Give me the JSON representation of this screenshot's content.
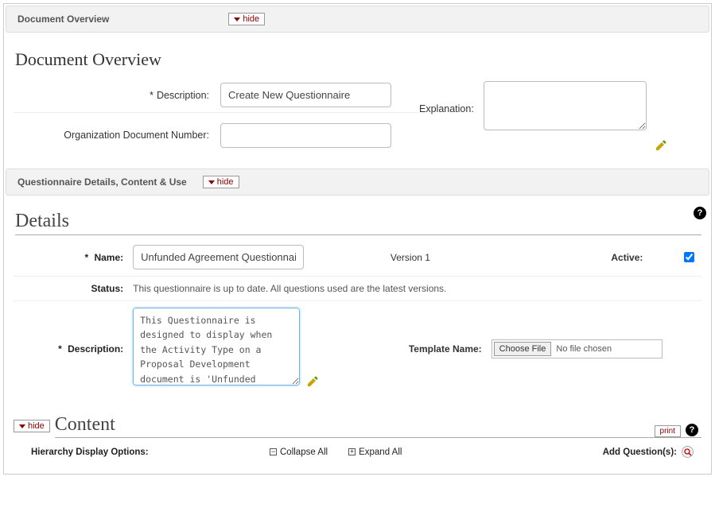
{
  "buttons": {
    "hide": "hide",
    "print": "print",
    "choose_file": "Choose File"
  },
  "doc_overview": {
    "header_title": "Document Overview",
    "section_title": "Document Overview",
    "description_label": "Description:",
    "description_value": "Create New Questionnaire",
    "org_doc_label": "Organization Document Number:",
    "org_doc_value": "",
    "explanation_label": "Explanation:",
    "explanation_value": ""
  },
  "qdetails_header": {
    "title": "Questionnaire Details, Content & Use"
  },
  "details": {
    "title": "Details",
    "name_label": "Name:",
    "name_value": "Unfunded Agreement Questionnaire",
    "version_label": "Version 1",
    "active_label": "Active:",
    "active_checked": true,
    "status_label": "Status:",
    "status_text": "This questionnaire is up to date. All questions used are the latest versions.",
    "description_label": "Description:",
    "description_value": "This Questionnaire is designed to display when the Activity Type on a Proposal Development document is 'Unfunded Agreement.",
    "template_label": "Template Name:",
    "no_file_text": "No file chosen"
  },
  "content": {
    "title": "Content",
    "hierarchy_label": "Hierarchy Display Options:",
    "collapse_all": "Collapse All",
    "expand_all": "Expand All",
    "add_questions": "Add Question(s):"
  }
}
